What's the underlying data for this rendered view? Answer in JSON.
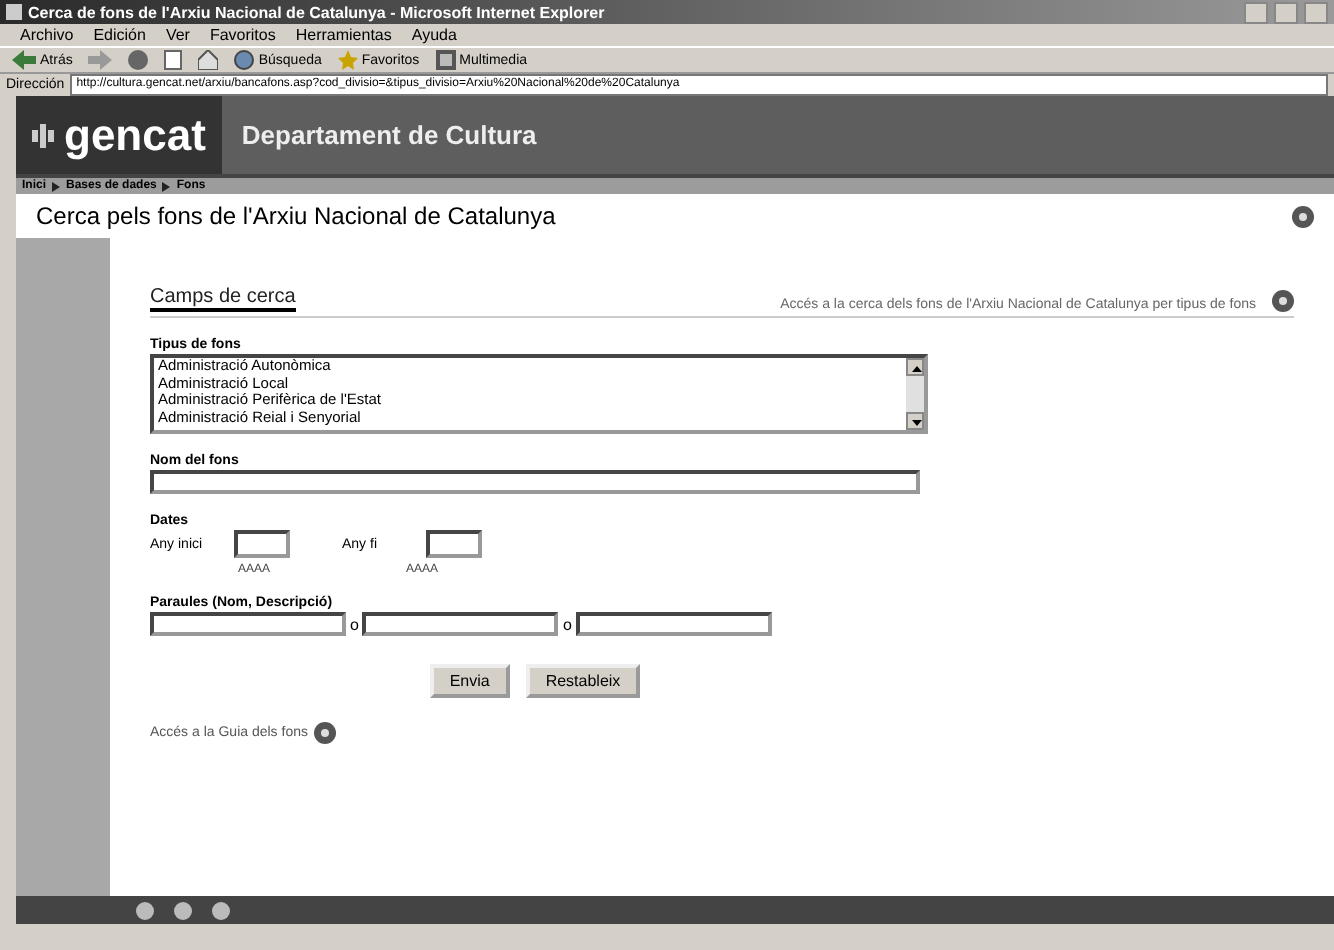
{
  "window": {
    "title": "Cerca de fons de l'Arxiu Nacional de Catalunya - Microsoft Internet Explorer"
  },
  "menu": [
    "Archivo",
    "Edición",
    "Ver",
    "Favoritos",
    "Herramientas",
    "Ayuda"
  ],
  "toolbar": [
    {
      "kind": "back",
      "label": "Atrás"
    },
    {
      "kind": "forward"
    },
    {
      "kind": "stop"
    },
    {
      "kind": "refresh"
    },
    {
      "kind": "home"
    },
    {
      "kind": "search",
      "label": "Búsqueda"
    },
    {
      "kind": "favorites",
      "label": "Favoritos"
    },
    {
      "kind": "media",
      "label": "Multimedia"
    }
  ],
  "address": {
    "label": "Dirección",
    "value": "http://cultura.gencat.net/arxiu/bancafons.asp?cod_divisio=&tipus_divisio=Arxiu%20Nacional%20de%20Catalunya"
  },
  "banner": {
    "logo": "gencat",
    "department": "Departament de Cultura"
  },
  "breadcrumb": [
    "Inici",
    "Bases de dades",
    "Fons"
  ],
  "page_title": "Cerca pels fons de l'Arxiu Nacional de Catalunya",
  "section_title": "Camps de cerca",
  "type_link": "Accés a la cerca dels fons de l'Arxiu Nacional de Catalunya per tipus de fons",
  "fund_type": {
    "label": "Tipus de fons",
    "options": [
      "Administració Autonòmica",
      "Administració Local",
      "Administració Perifèrica de l'Estat",
      "Administració Reial i Senyorial"
    ]
  },
  "fund_name": {
    "label": "Nom del fons"
  },
  "dates": {
    "label": "Dates",
    "from_label": "Any inici",
    "to_label": "Any fi",
    "from_hint": "AAAA",
    "to_hint": "AAAA"
  },
  "words": {
    "label": "Paraules (Nom, Descripció)",
    "separators": [
      "o",
      "o"
    ]
  },
  "buttons": [
    "Envia",
    "Restableix"
  ],
  "guide_link": "Accés a la Guia dels fons"
}
